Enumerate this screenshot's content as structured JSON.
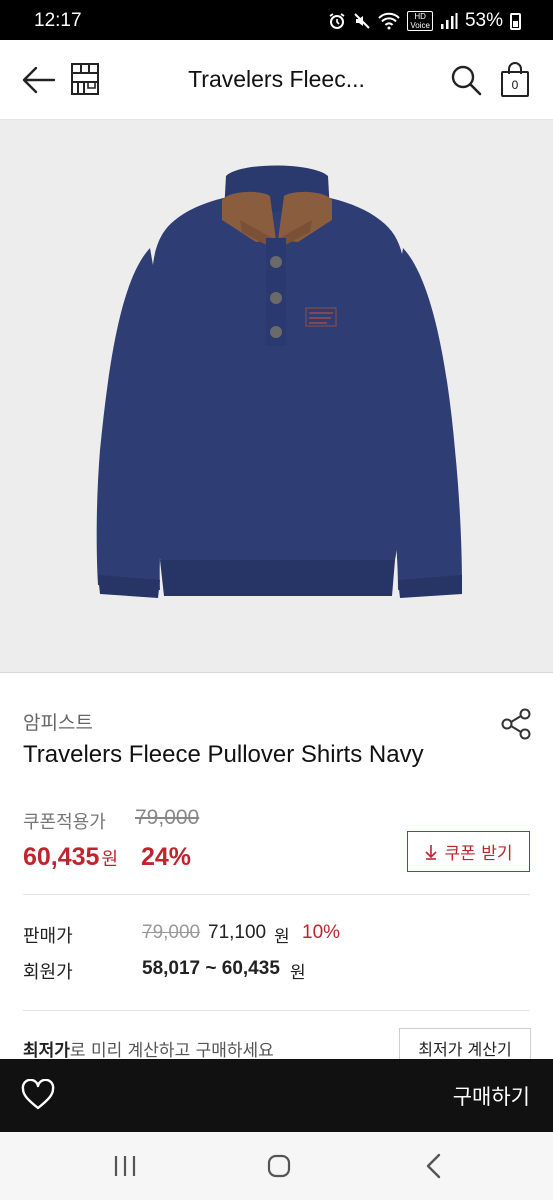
{
  "status_bar": {
    "time": "12:17",
    "hd_label": "HD",
    "voice_label": "Voice",
    "battery": "53%",
    "icons": [
      "alarm-icon",
      "mute-icon",
      "wifi-icon",
      "signal-icon",
      "battery-icon"
    ]
  },
  "header": {
    "title": "Travelers Fleec...",
    "cart_count": "0",
    "icons": [
      "back-arrow-icon",
      "store-icon",
      "search-icon",
      "cart-bag-icon"
    ]
  },
  "product": {
    "brand": "암피스트",
    "name": "Travelers Fleece Pullover Shirts Navy",
    "image_colors": {
      "body": "#2e3e74",
      "collar": "#8a5d3f",
      "background": "#ededed"
    }
  },
  "coupon": {
    "label": "쿠폰적용가",
    "original_price": "79,000",
    "price": "60,435",
    "won": "원",
    "rate": "24%",
    "button_label": "쿠폰 받기",
    "button_icon": "download-arrow-icon"
  },
  "sale": {
    "label": "판매가",
    "original_price": "79,000",
    "price": "71,100",
    "won": "원",
    "rate": "10%"
  },
  "member": {
    "label": "회원가",
    "range": "58,017 ~ 60,435",
    "won": "원"
  },
  "lowest": {
    "bold": "최저가",
    "rest": "로 미리 계산하고 구매하세요",
    "button_label": "최저가 계산기"
  },
  "buy_bar": {
    "buy_label": "구매하기",
    "icon": "heart-icon"
  },
  "nav_bar": {
    "icons": [
      "recent-apps-icon",
      "home-icon",
      "back-icon"
    ]
  },
  "colors": {
    "accent_red": "#c0242e",
    "buy_bar": "#111111"
  }
}
